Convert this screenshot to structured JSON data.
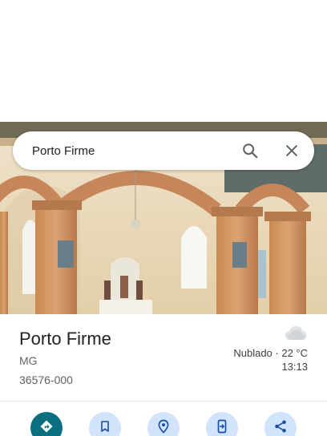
{
  "search": {
    "value": "Porto Firme",
    "search_icon": "search-icon",
    "close_icon": "close-icon"
  },
  "photo": {
    "subject": "church-interior-photo"
  },
  "place": {
    "title": "Porto Firme",
    "region": "MG",
    "postcode": "36576-000"
  },
  "weather": {
    "icon": "cloud-icon",
    "summary": "Nublado · 22 °C",
    "time": "13:13"
  },
  "actions": [
    {
      "name": "directions",
      "icon": "directions-icon"
    },
    {
      "name": "save",
      "icon": "bookmark-icon"
    },
    {
      "name": "nearby",
      "icon": "nearby-pin-icon"
    },
    {
      "name": "send-to-device",
      "icon": "send-to-phone-icon"
    },
    {
      "name": "share",
      "icon": "share-icon"
    }
  ],
  "colors": {
    "primary_action": "#0b6f80",
    "secondary_action": "#d2e3fc",
    "icon_blue": "#1a73e8"
  }
}
